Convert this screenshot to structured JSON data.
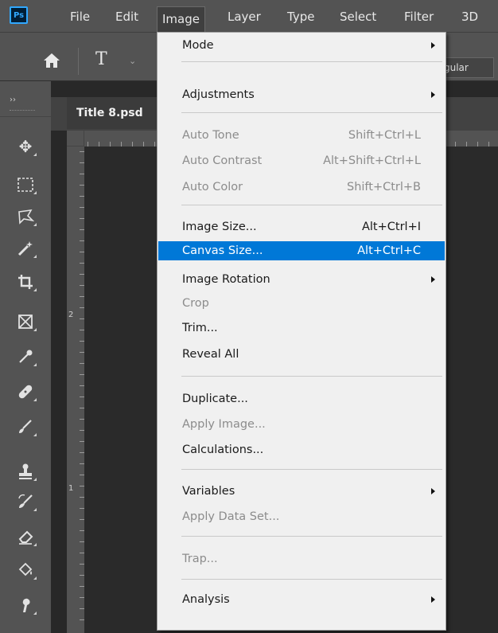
{
  "app": {
    "logo": "Ps"
  },
  "menubar": {
    "items": [
      "File",
      "Edit",
      "Image",
      "Layer",
      "Type",
      "Select",
      "Filter",
      "3D"
    ]
  },
  "options": {
    "font_style": "gular"
  },
  "toolbar": {
    "collapse": "››"
  },
  "document": {
    "tab_title": "Title 8.psd",
    "ruler_labels": [
      "2",
      "1"
    ]
  },
  "image_menu": {
    "mode": "Mode",
    "adjustments": "Adjustments",
    "auto_tone": "Auto Tone",
    "auto_tone_sc": "Shift+Ctrl+L",
    "auto_contrast": "Auto Contrast",
    "auto_contrast_sc": "Alt+Shift+Ctrl+L",
    "auto_color": "Auto Color",
    "auto_color_sc": "Shift+Ctrl+B",
    "image_size": "Image Size...",
    "image_size_sc": "Alt+Ctrl+I",
    "canvas_size": "Canvas Size...",
    "canvas_size_sc": "Alt+Ctrl+C",
    "image_rotation": "Image Rotation",
    "crop": "Crop",
    "trim": "Trim...",
    "reveal_all": "Reveal All",
    "duplicate": "Duplicate...",
    "apply_image": "Apply Image...",
    "calculations": "Calculations...",
    "variables": "Variables",
    "apply_data_set": "Apply Data Set...",
    "trap": "Trap...",
    "analysis": "Analysis"
  },
  "colors": {
    "highlight": "#0078d7",
    "ps_blue": "#31a8ff"
  },
  "icons": [
    "home-icon",
    "type-tool-icon",
    "move-tool-icon",
    "marquee-tool-icon",
    "lasso-tool-icon",
    "magic-wand-icon",
    "crop-tool-icon",
    "frame-tool-icon",
    "eyedropper-icon",
    "healing-brush-icon",
    "brush-icon",
    "clone-stamp-icon",
    "history-brush-icon",
    "eraser-icon",
    "paint-bucket-icon",
    "smudge-icon"
  ]
}
